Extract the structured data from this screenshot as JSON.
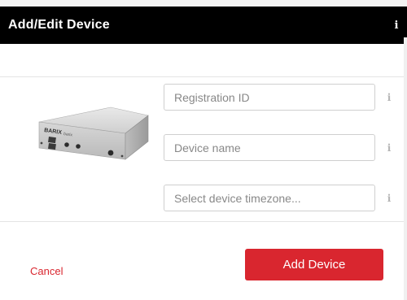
{
  "dialog": {
    "title": "Add/Edit Device",
    "info_icon": "info-icon"
  },
  "device_image": {
    "brand": "BARIX",
    "model_badge": "barix"
  },
  "form": {
    "registration_id": {
      "value": "",
      "placeholder": "Registration ID"
    },
    "device_name": {
      "value": "",
      "placeholder": "Device name"
    },
    "timezone": {
      "value": "",
      "placeholder": "Select device timezone..."
    }
  },
  "footer": {
    "cancel_label": "Cancel",
    "add_label": "Add Device"
  },
  "colors": {
    "header_bg": "#000000",
    "accent": "#d9262f",
    "info_icon_muted": "#b5b5b5"
  }
}
